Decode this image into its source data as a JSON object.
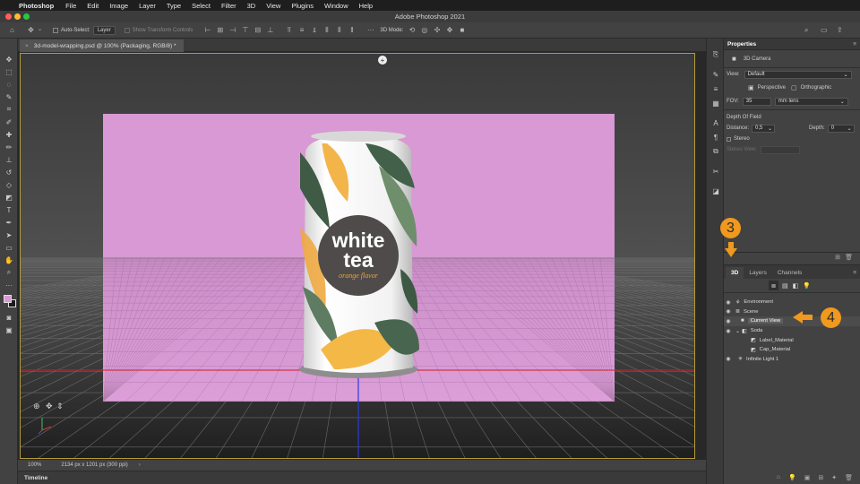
{
  "menubar": {
    "app": "Photoshop",
    "items": [
      "File",
      "Edit",
      "Image",
      "Layer",
      "Type",
      "Select",
      "Filter",
      "3D",
      "View",
      "Plugins",
      "Window",
      "Help"
    ]
  },
  "window_title": "Adobe Photoshop 2021",
  "options": {
    "auto_select_label": "Auto-Select:",
    "auto_select_value": "Layer",
    "transform_label": "Show Transform Controls",
    "mode_label": "3D Mode:"
  },
  "document": {
    "tab_label": "3d-model-wrapping.psd @ 100% (Packaging, RGB/8) *"
  },
  "can": {
    "line1": "white",
    "line2": "tea",
    "flavor": "orange flavor"
  },
  "status": {
    "zoom": "100%",
    "doc_size": "2134 px x 1201 px (300 ppi)"
  },
  "timeline_label": "Timeline",
  "properties": {
    "title": "Properties",
    "camera_label": "3D Camera",
    "view_label": "View:",
    "view_value": "Default",
    "perspective": "Perspective",
    "orthographic": "Orthographic",
    "fov_label": "FOV:",
    "fov_value": "35",
    "fov_unit": "mm lens",
    "dof_label": "Depth Of Field",
    "distance_label": "Distance:",
    "distance_value": "0,5",
    "depth_label": "Depth:",
    "depth_value": "0",
    "stereo_label": "Stereo",
    "stereo_view_label": "Stereo View:"
  },
  "panel3d": {
    "tabs": [
      "3D",
      "Layers",
      "Channels"
    ],
    "items": [
      "Environment",
      "Scene",
      "Current View",
      "Soda",
      "Label_Material",
      "Cap_Material",
      "Infinite Light 1"
    ]
  },
  "annotations": {
    "step_a": "3",
    "step_b": "4"
  },
  "colors": {
    "accent": "#f0991e",
    "backdrop": "#d899d4",
    "can_circle": "#4f4b4b"
  }
}
